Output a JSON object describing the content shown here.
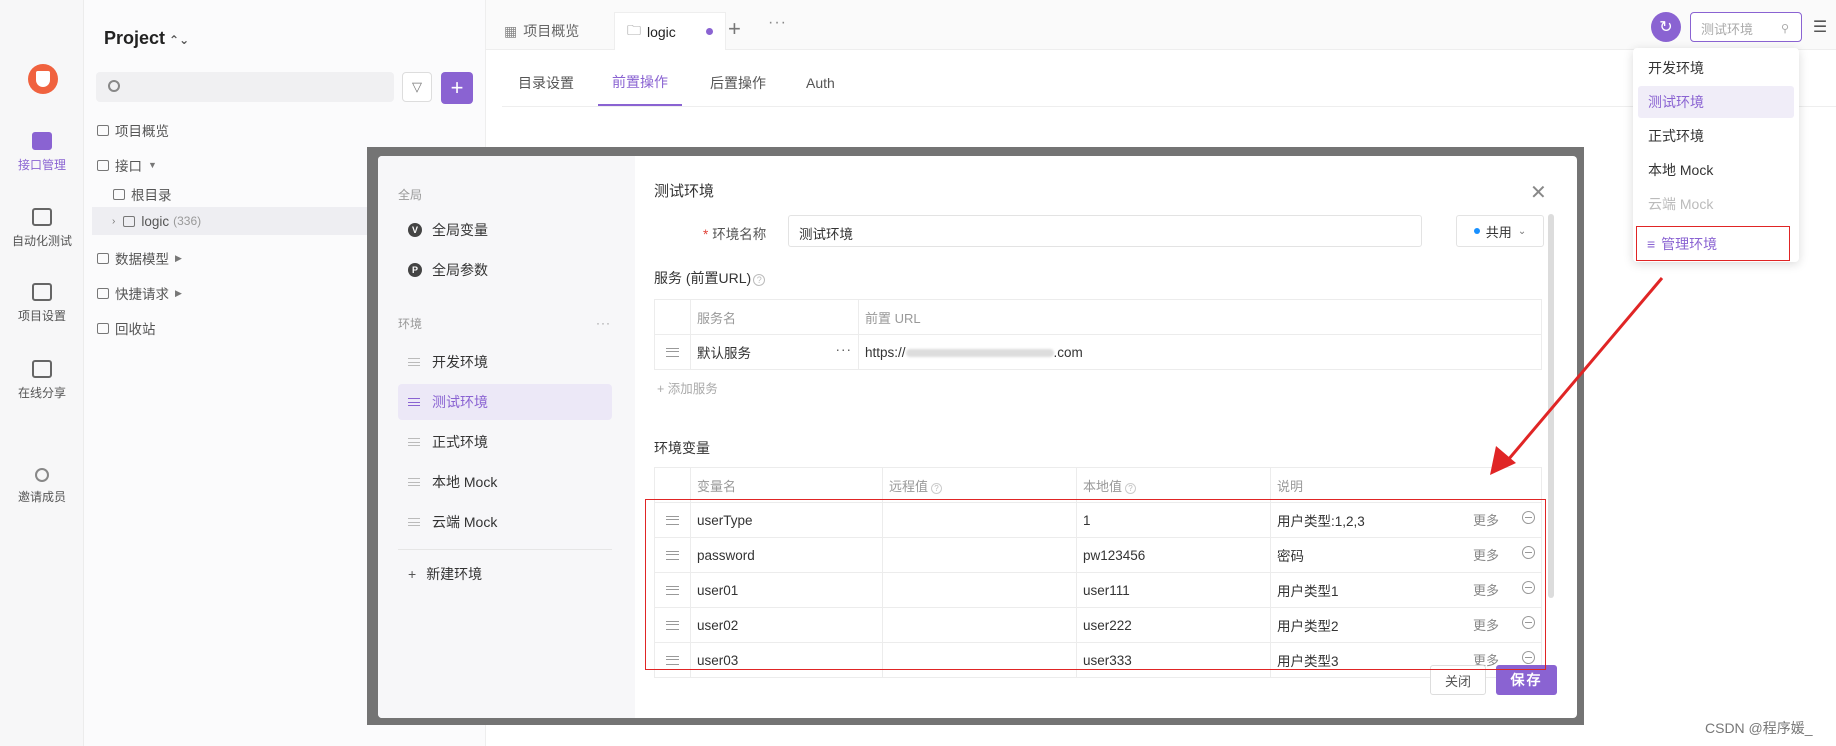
{
  "rail": {
    "items": [
      {
        "label": "接口管理"
      },
      {
        "label": "自动化测试"
      },
      {
        "label": "项目设置"
      },
      {
        "label": "在线分享"
      },
      {
        "label": "邀请成员"
      }
    ]
  },
  "sidebar": {
    "project_title": "Project",
    "tree": [
      {
        "label": "项目概览"
      },
      {
        "label": "接口"
      },
      {
        "label": "根目录"
      },
      {
        "label": "logic",
        "count": "(336)"
      },
      {
        "label": "数据模型"
      },
      {
        "label": "快捷请求"
      },
      {
        "label": "回收站"
      }
    ]
  },
  "header": {
    "tabs": [
      {
        "label": "项目概览"
      },
      {
        "label": "logic"
      }
    ],
    "env_select_value": "测试环境"
  },
  "subtabs": [
    "目录设置",
    "前置操作",
    "后置操作",
    "Auth"
  ],
  "modal": {
    "left": {
      "global_section": "全局",
      "global_items": [
        {
          "icon": "V",
          "label": "全局变量"
        },
        {
          "icon": "P",
          "label": "全局参数"
        }
      ],
      "env_section": "环境",
      "env_items": [
        "开发环境",
        "测试环境",
        "正式环境",
        "本地 Mock",
        "云端 Mock"
      ],
      "new_env": "新建环境"
    },
    "title": "测试环境",
    "env_name_label": "环境名称",
    "env_name_value": "测试环境",
    "share_label": "共用",
    "service_section": "服务 (前置URL)",
    "service_headers": [
      "服务名",
      "前置 URL"
    ],
    "services": [
      {
        "name": "默认服务",
        "url": "https://",
        "url_tail": ".com"
      }
    ],
    "add_service": "+ 添加服务",
    "vars_section": "环境变量",
    "var_headers": [
      "变量名",
      "远程值",
      "本地值",
      "说明"
    ],
    "vars": [
      {
        "name": "userType",
        "remote": "",
        "local": "1",
        "desc": "用户类型:1,2,3",
        "more": "更多"
      },
      {
        "name": "password",
        "remote": "",
        "local": "pw123456",
        "desc": "密码",
        "more": "更多"
      },
      {
        "name": "user01",
        "remote": "",
        "local": "user111",
        "desc": "用户类型1",
        "more": "更多"
      },
      {
        "name": "user02",
        "remote": "",
        "local": "user222",
        "desc": "用户类型2",
        "more": "更多"
      },
      {
        "name": "user03",
        "remote": "",
        "local": "user333",
        "desc": "用户类型3",
        "more": "更多"
      }
    ],
    "close_btn": "关闭",
    "save_btn": "保存"
  },
  "env_dropdown": {
    "items": [
      "开发环境",
      "测试环境",
      "正式环境",
      "本地 Mock",
      "云端 Mock"
    ],
    "manage": "管理环境"
  },
  "watermark": "CSDN @程序媛_",
  "colors": {
    "accent": "#8a63d2",
    "highlight": "#e02525"
  }
}
